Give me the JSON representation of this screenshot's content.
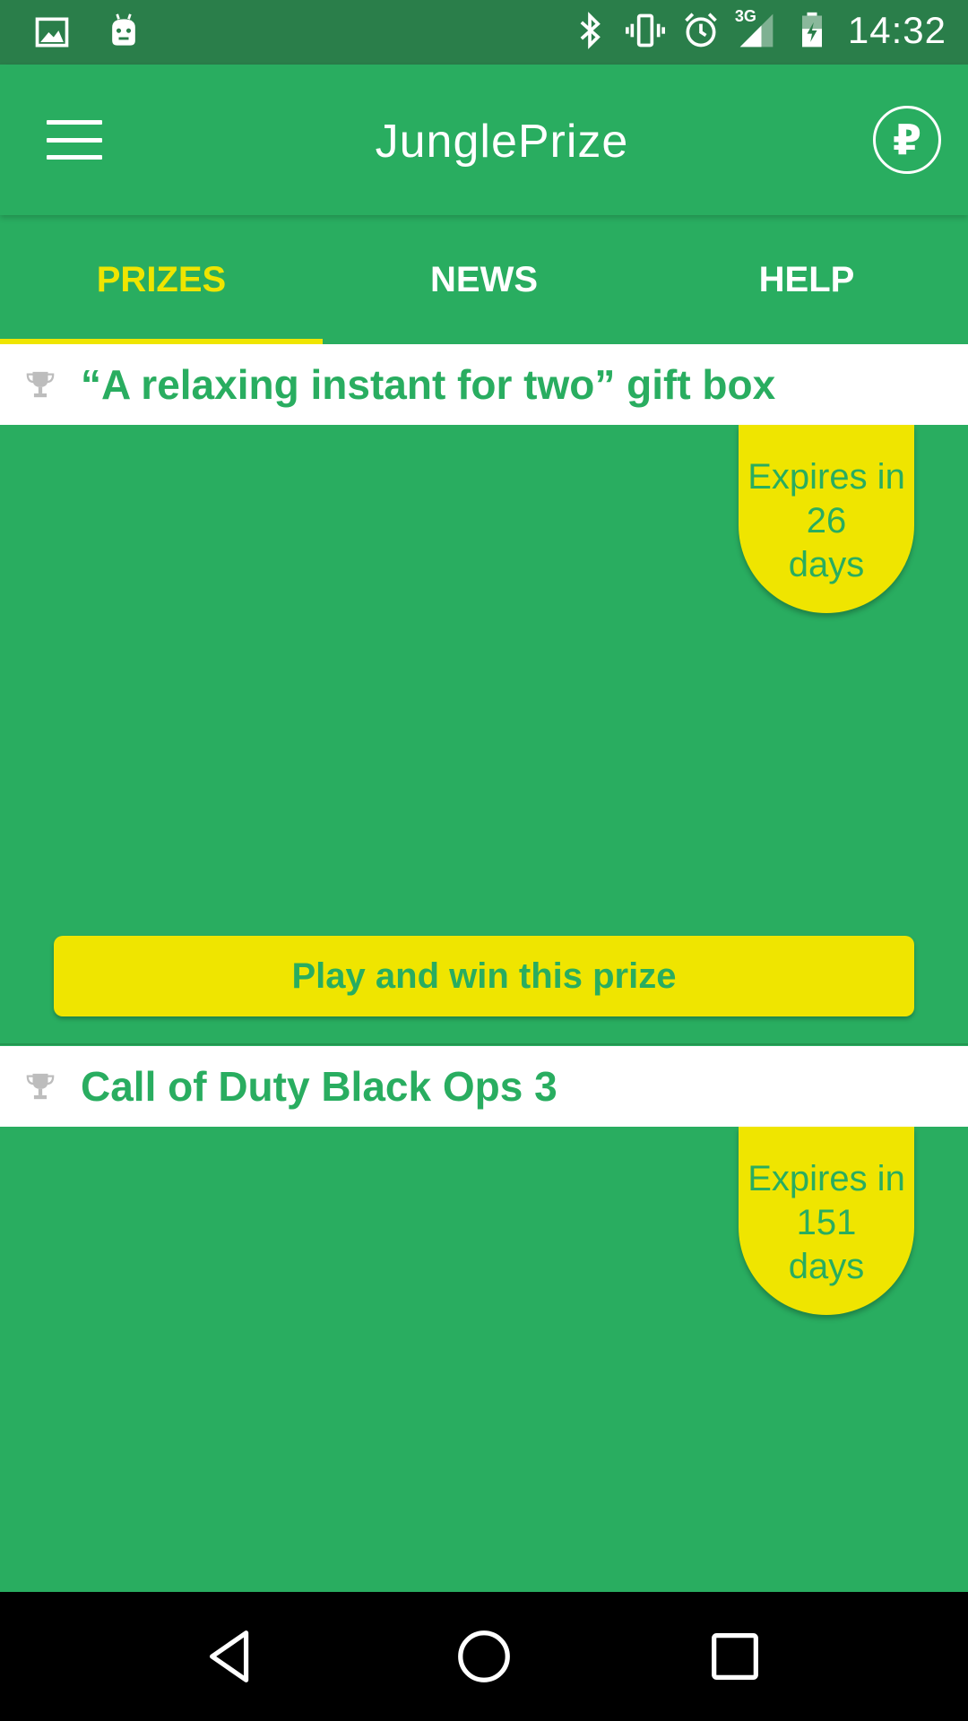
{
  "status_bar": {
    "time": "14:32",
    "network": "3G",
    "left_icons": [
      "image-icon",
      "android-icon"
    ],
    "right_icons": [
      "bluetooth-icon",
      "vibrate-icon",
      "alarm-icon",
      "signal-icon",
      "battery-icon"
    ]
  },
  "app_bar": {
    "title": "JunglePrize",
    "coin_symbol": "₽"
  },
  "tabs": [
    {
      "label": "PRIZES",
      "active": true
    },
    {
      "label": "NEWS",
      "active": false
    },
    {
      "label": "HELP",
      "active": false
    }
  ],
  "prizes": [
    {
      "title": "“A relaxing instant for two” gift box",
      "expires": {
        "line1": "Expires in",
        "days": "26",
        "line3": "days"
      },
      "action": "Play and win this prize"
    },
    {
      "title": "Call of Duty Black Ops 3",
      "expires": {
        "line1": "Expires in",
        "days": "151",
        "line3": "days"
      }
    }
  ],
  "colors": {
    "primary": "#29AD60",
    "status_bar": "#2A7E4A",
    "accent": "#EFE500",
    "nav_bar": "#000000"
  }
}
